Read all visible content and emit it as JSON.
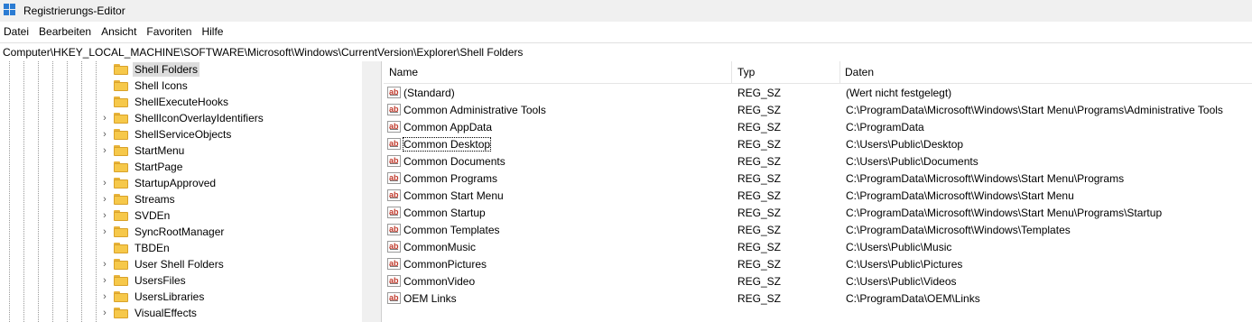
{
  "window": {
    "title": "Registrierungs-Editor"
  },
  "menu": {
    "items": [
      "Datei",
      "Bearbeiten",
      "Ansicht",
      "Favoriten",
      "Hilfe"
    ]
  },
  "address": {
    "path": "Computer\\HKEY_LOCAL_MACHINE\\SOFTWARE\\Microsoft\\Windows\\CurrentVersion\\Explorer\\Shell Folders"
  },
  "tree": {
    "items": [
      {
        "label": "Shell Folders",
        "expandable": false,
        "selected": true
      },
      {
        "label": "Shell Icons",
        "expandable": false,
        "selected": false
      },
      {
        "label": "ShellExecuteHooks",
        "expandable": false,
        "selected": false
      },
      {
        "label": "ShellIconOverlayIdentifiers",
        "expandable": true,
        "selected": false
      },
      {
        "label": "ShellServiceObjects",
        "expandable": true,
        "selected": false
      },
      {
        "label": "StartMenu",
        "expandable": true,
        "selected": false
      },
      {
        "label": "StartPage",
        "expandable": false,
        "selected": false
      },
      {
        "label": "StartupApproved",
        "expandable": true,
        "selected": false
      },
      {
        "label": "Streams",
        "expandable": true,
        "selected": false
      },
      {
        "label": "SVDEn",
        "expandable": true,
        "selected": false
      },
      {
        "label": "SyncRootManager",
        "expandable": true,
        "selected": false
      },
      {
        "label": "TBDEn",
        "expandable": false,
        "selected": false
      },
      {
        "label": "User Shell Folders",
        "expandable": true,
        "selected": false
      },
      {
        "label": "UsersFiles",
        "expandable": true,
        "selected": false
      },
      {
        "label": "UsersLibraries",
        "expandable": true,
        "selected": false
      },
      {
        "label": "VisualEffects",
        "expandable": true,
        "selected": false
      }
    ]
  },
  "list": {
    "columns": {
      "name": "Name",
      "type": "Typ",
      "data": "Daten"
    },
    "rows": [
      {
        "name": "(Standard)",
        "type": "REG_SZ",
        "data": "(Wert nicht festgelegt)",
        "focused": false
      },
      {
        "name": "Common Administrative Tools",
        "type": "REG_SZ",
        "data": "C:\\ProgramData\\Microsoft\\Windows\\Start Menu\\Programs\\Administrative Tools",
        "focused": false
      },
      {
        "name": "Common AppData",
        "type": "REG_SZ",
        "data": "C:\\ProgramData",
        "focused": false
      },
      {
        "name": "Common Desktop",
        "type": "REG_SZ",
        "data": "C:\\Users\\Public\\Desktop",
        "focused": true
      },
      {
        "name": "Common Documents",
        "type": "REG_SZ",
        "data": "C:\\Users\\Public\\Documents",
        "focused": false
      },
      {
        "name": "Common Programs",
        "type": "REG_SZ",
        "data": "C:\\ProgramData\\Microsoft\\Windows\\Start Menu\\Programs",
        "focused": false
      },
      {
        "name": "Common Start Menu",
        "type": "REG_SZ",
        "data": "C:\\ProgramData\\Microsoft\\Windows\\Start Menu",
        "focused": false
      },
      {
        "name": "Common Startup",
        "type": "REG_SZ",
        "data": "C:\\ProgramData\\Microsoft\\Windows\\Start Menu\\Programs\\Startup",
        "focused": false
      },
      {
        "name": "Common Templates",
        "type": "REG_SZ",
        "data": "C:\\ProgramData\\Microsoft\\Windows\\Templates",
        "focused": false
      },
      {
        "name": "CommonMusic",
        "type": "REG_SZ",
        "data": "C:\\Users\\Public\\Music",
        "focused": false
      },
      {
        "name": "CommonPictures",
        "type": "REG_SZ",
        "data": "C:\\Users\\Public\\Pictures",
        "focused": false
      },
      {
        "name": "CommonVideo",
        "type": "REG_SZ",
        "data": "C:\\Users\\Public\\Videos",
        "focused": false
      },
      {
        "name": "OEM Links",
        "type": "REG_SZ",
        "data": "C:\\ProgramData\\OEM\\Links",
        "focused": false
      }
    ]
  }
}
